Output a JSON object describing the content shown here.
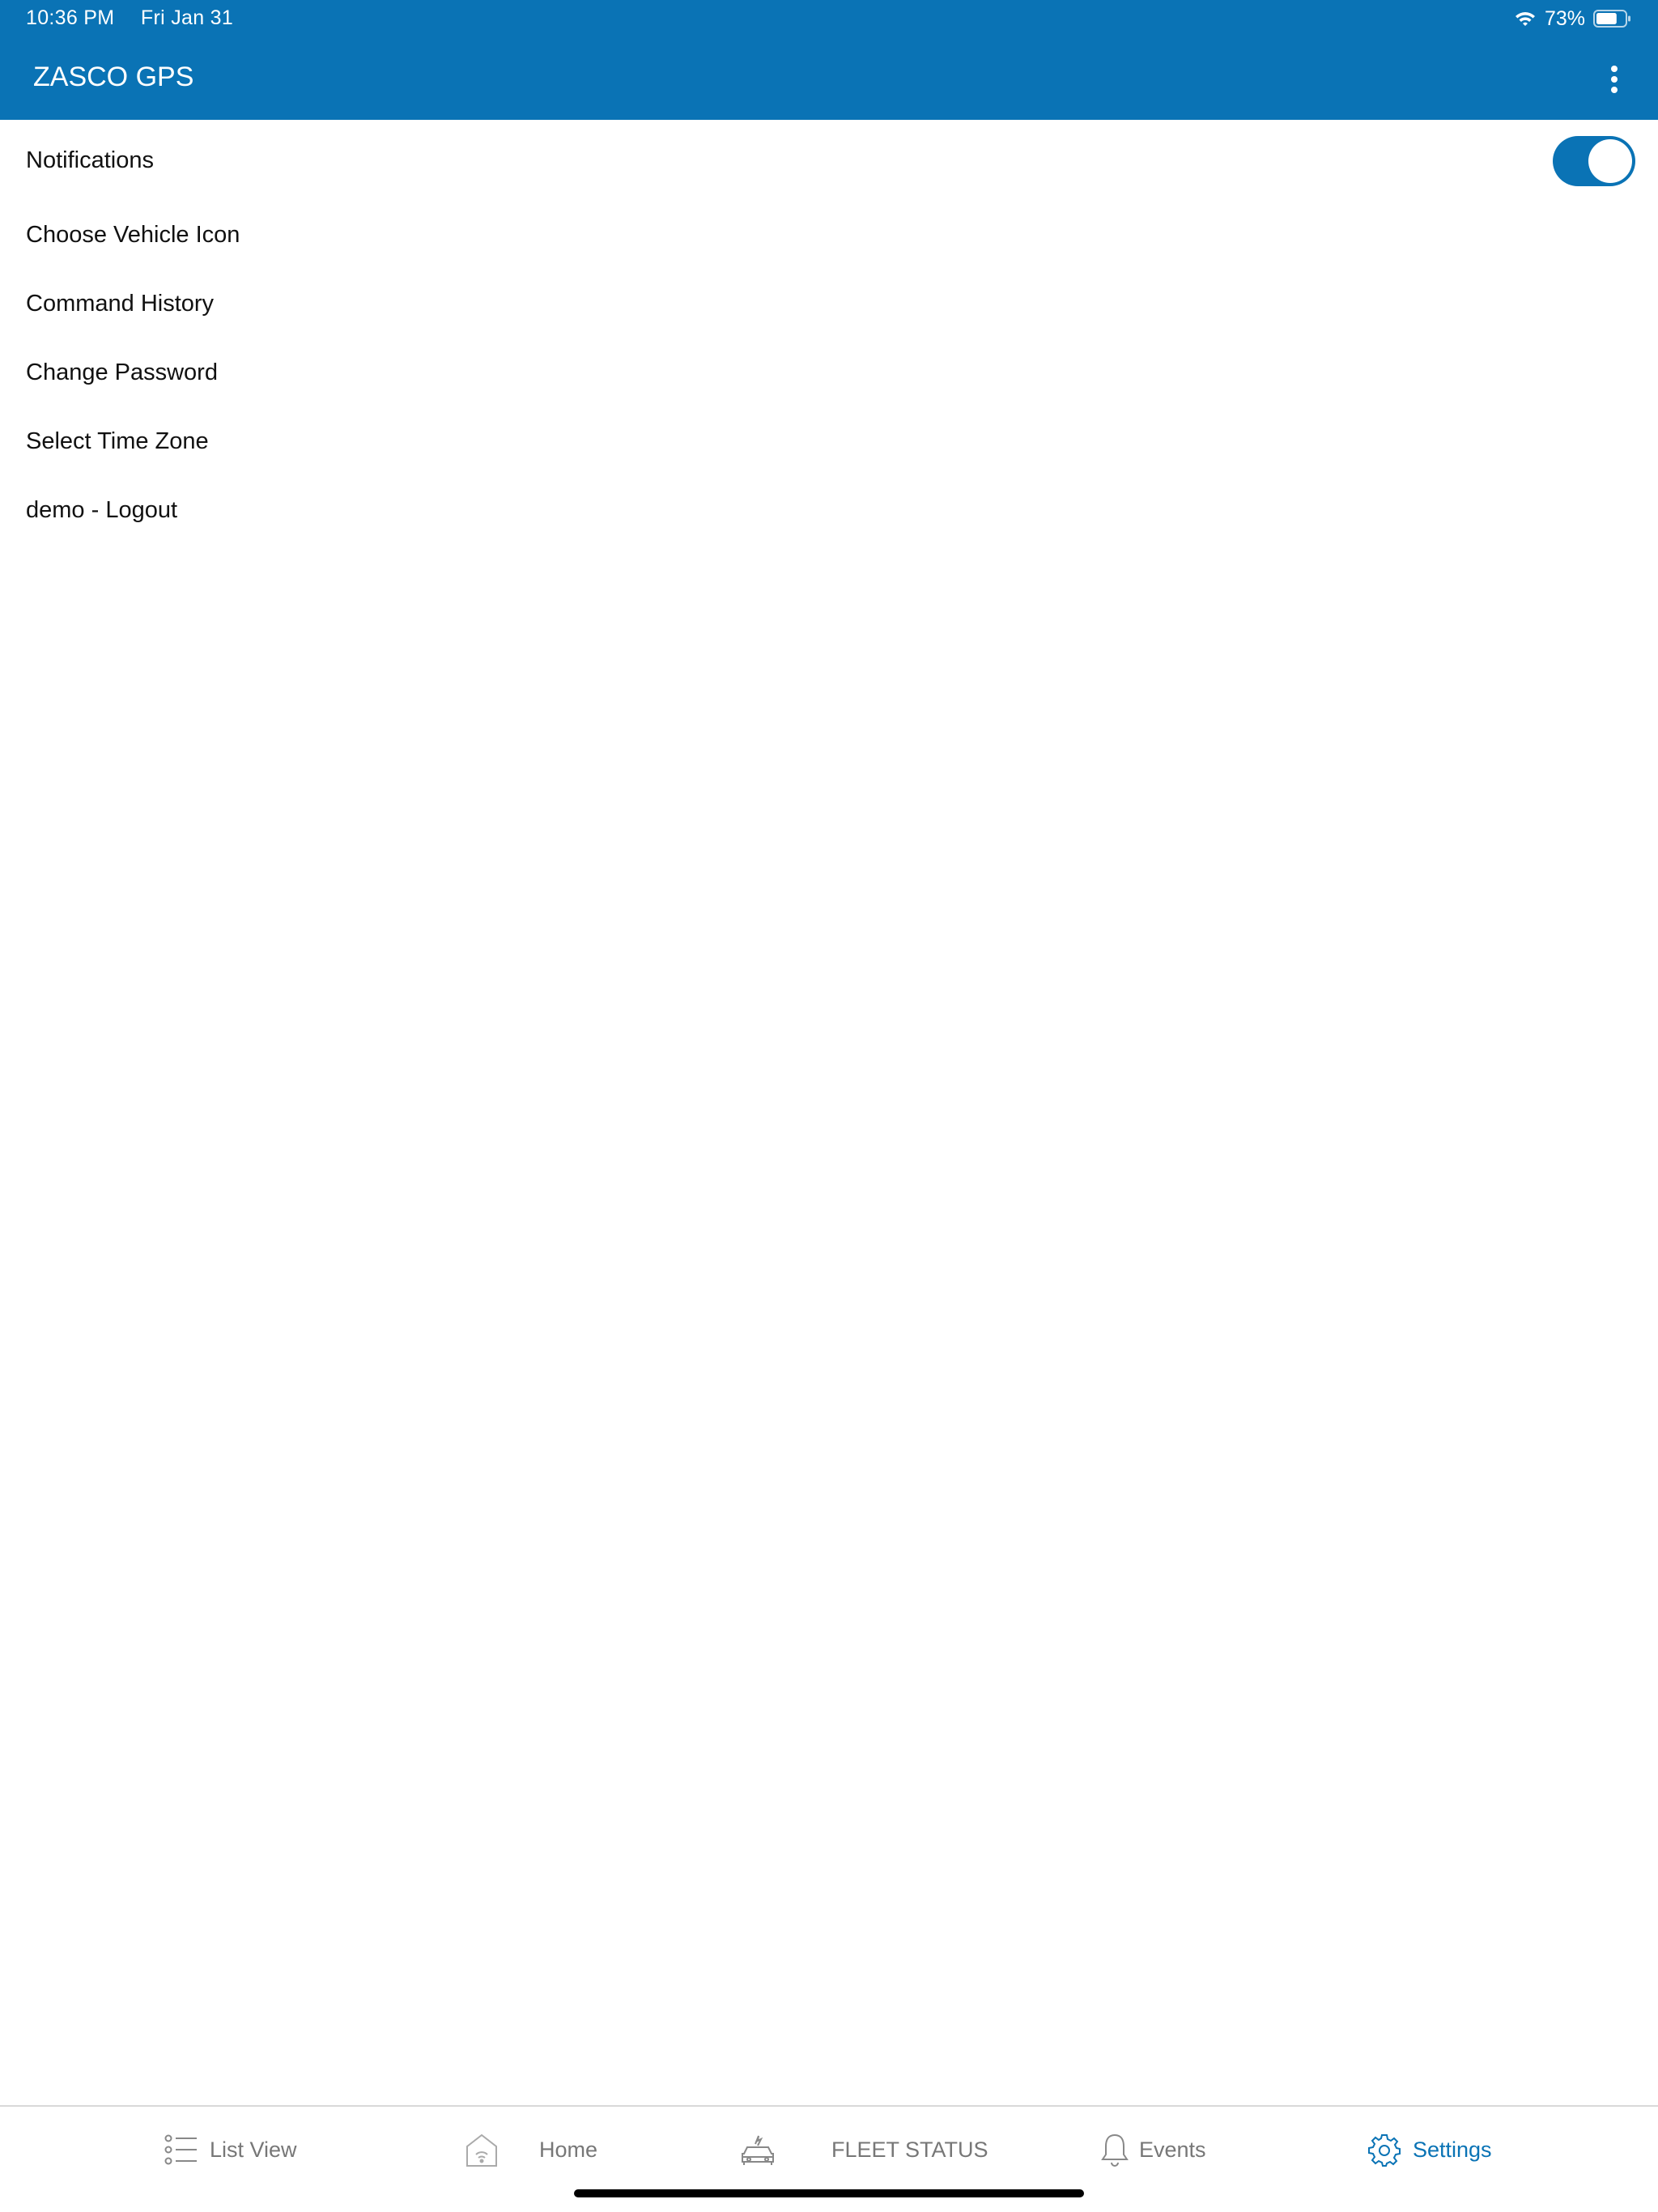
{
  "status_bar": {
    "time": "10:36 PM",
    "date": "Fri Jan 31",
    "battery_percent": "73%",
    "battery_level": 0.73,
    "wifi_icon": "wifi-icon",
    "battery_icon": "battery-icon"
  },
  "app_bar": {
    "title": "ZASCO GPS",
    "menu_icon": "more-vertical-icon",
    "color": "#0a73b5"
  },
  "settings": {
    "items": [
      {
        "label": "Notifications",
        "toggle": true
      },
      {
        "label": "Choose Vehicle Icon"
      },
      {
        "label": "Command History"
      },
      {
        "label": "Change Password"
      },
      {
        "label": "Select Time Zone"
      },
      {
        "label": "demo - Logout"
      }
    ]
  },
  "tabbar": {
    "tabs": [
      {
        "label": "List View",
        "icon": "list-icon",
        "active": false
      },
      {
        "label": "Home",
        "icon": "home-icon",
        "active": false
      },
      {
        "label": "FLEET STATUS",
        "icon": "car-icon",
        "active": false
      },
      {
        "label": "Events",
        "icon": "bell-icon",
        "active": false
      },
      {
        "label": "Settings",
        "icon": "gear-icon",
        "active": true
      }
    ],
    "active_color": "#0a73b5",
    "inactive_color": "#777777"
  }
}
